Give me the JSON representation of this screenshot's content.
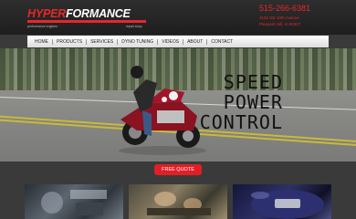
{
  "header": {
    "logo_hyper": "HYPER",
    "logo_formance": "FORMANCE",
    "logo_tagline_left": "performance engines",
    "logo_tagline_right": "repair shop",
    "phone": "515-266-6381",
    "address_line1": "3101 NE 10th Avenue",
    "address_line2": "Pleasant Hill, IA 50327"
  },
  "nav": {
    "items": [
      "HOME",
      "PRODUCTS",
      "SERVICES",
      "DYNO TUNING",
      "VIDEOS",
      "ABOUT",
      "CONTACT"
    ]
  },
  "hero": {
    "lines": [
      "SPEED",
      "POWER",
      "CONTROL"
    ]
  },
  "cta": {
    "quote_label": "FREE QUOTE"
  },
  "colors": {
    "accent": "#e8262a",
    "button": "#e01f26"
  }
}
